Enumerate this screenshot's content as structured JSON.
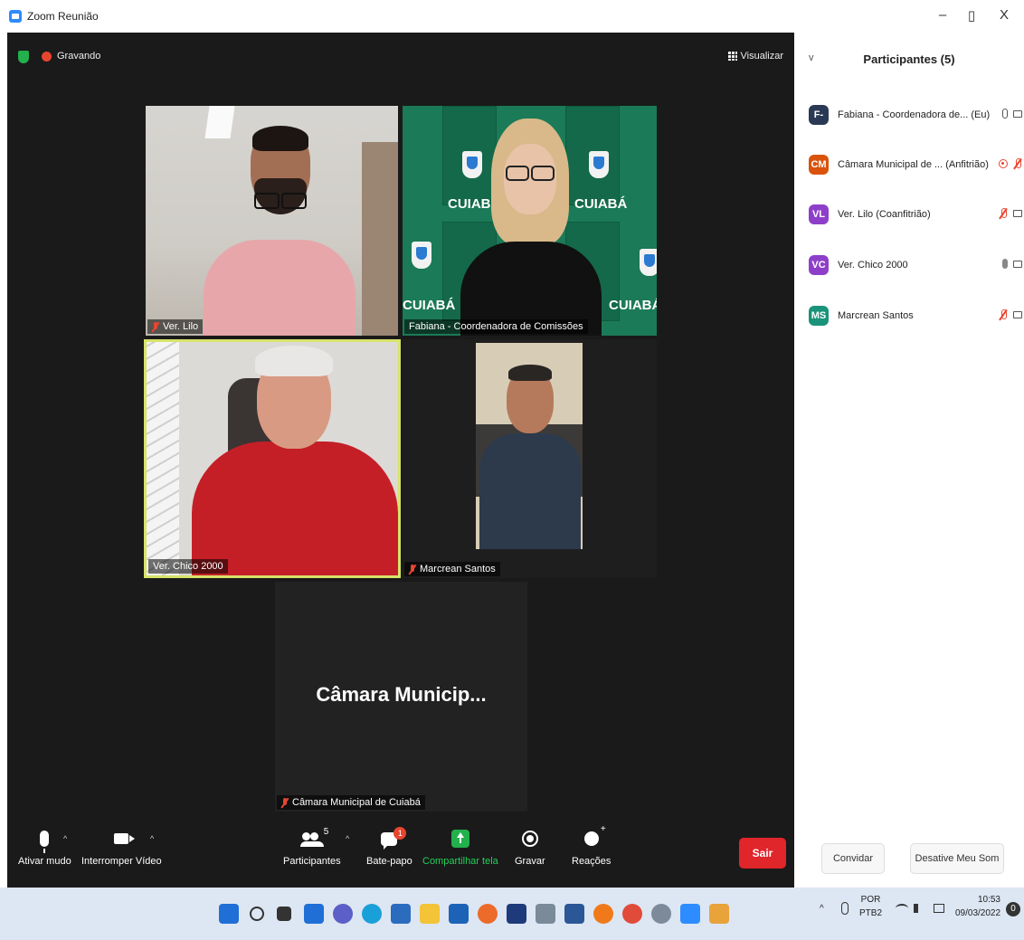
{
  "window": {
    "title": "Zoom Reunião",
    "minimize": "–",
    "restore": "▯",
    "close": "X"
  },
  "meeting": {
    "recording_label": "Gravando",
    "view_label": "Visualizar",
    "tiles": [
      {
        "name": "Ver. Lilo",
        "muted": true
      },
      {
        "name": "Fabiana - Coordenadora de Comissões",
        "muted": false
      },
      {
        "name": "Ver. Chico 2000",
        "muted": false,
        "active_speaker": true
      },
      {
        "name": "Marcrean Santos",
        "muted": true
      },
      {
        "name": "Câmara Municipal de Cuiabá",
        "muted": true,
        "video_off_label": "Câmara Municip..."
      }
    ],
    "background_text": "CUIABÁ"
  },
  "toolbar": {
    "mute_label": "Ativar mudo",
    "video_label": "Interromper Vídeo",
    "participants_label": "Participantes",
    "participants_count": "5",
    "chat_label": "Bate-papo",
    "chat_badge": "1",
    "share_label": "Compartilhar tela",
    "record_label": "Gravar",
    "reactions_label": "Reações",
    "leave_label": "Sair",
    "caret": "^"
  },
  "panel": {
    "title": "Participantes (5)",
    "collapse_icon": "v",
    "participants": [
      {
        "initials": "F-",
        "name": "Fabiana - Coordenadora de... (Eu)",
        "color": "#2a3a55"
      },
      {
        "initials": "CM",
        "name": "Câmara Municipal de ... (Anfitrião)",
        "color": "#d9530c"
      },
      {
        "initials": "VL",
        "name": "Ver. Lilo (Coanfitrião)",
        "color": "#8e3fc9"
      },
      {
        "initials": "VC",
        "name": "Ver. Chico 2000",
        "color": "#8e3fc9"
      },
      {
        "initials": "MS",
        "name": "Marcrean Santos",
        "color": "#19947a"
      }
    ],
    "invite_label": "Convidar",
    "mute_all_label": "Desative Meu Som"
  },
  "taskbar": {
    "lang_top": "POR",
    "lang_bottom": "PTB2",
    "time": "10:53",
    "date": "09/03/2022",
    "notification_count": "0",
    "apps": [
      "windows-start-icon",
      "search-icon",
      "task-view-icon",
      "widgets-icon",
      "teams-icon",
      "edge-icon",
      "store-icon",
      "file-explorer-icon",
      "mail-icon",
      "firefox-icon",
      "dropbox-icon",
      "amazon-icon",
      "word-icon",
      "avast-icon",
      "chrome-icon",
      "settings-icon",
      "zoom-icon",
      "acrobat-icon"
    ]
  },
  "colors": {
    "zoom_blue": "#2d8cff",
    "leave_red": "#e0252b",
    "share_green": "#22b14c",
    "speaker_border": "#d7e36a",
    "meeting_bg": "#1a1a1a"
  }
}
